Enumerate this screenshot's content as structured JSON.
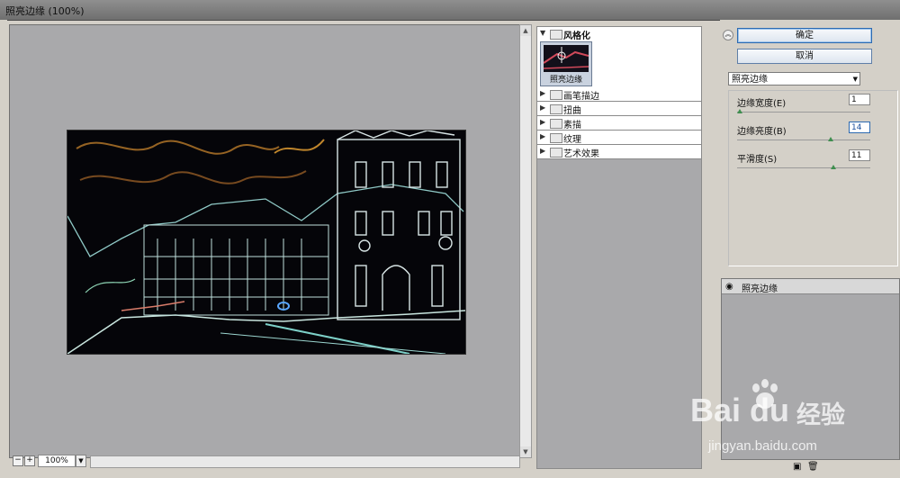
{
  "window": {
    "title": "照亮边缘 (100%)"
  },
  "preview": {
    "zoom": "100%",
    "zoom_out_icon": "minus-icon",
    "zoom_in_icon": "plus-icon"
  },
  "gallery": {
    "expanded_category": {
      "label": "风格化",
      "thumbnail_label": "照亮边缘"
    },
    "categories": [
      {
        "label": "画笔描边"
      },
      {
        "label": "扭曲"
      },
      {
        "label": "素描"
      },
      {
        "label": "纹理"
      },
      {
        "label": "艺术效果"
      }
    ]
  },
  "settings": {
    "ok_label": "确定",
    "cancel_label": "取消",
    "filter_select": "照亮边缘",
    "params": [
      {
        "label": "边缘宽度(E)",
        "value": "1",
        "level": 0.02
      },
      {
        "label": "边缘亮度(B)",
        "value": "14",
        "level": 0.7
      },
      {
        "label": "平滑度(S)",
        "value": "11",
        "level": 0.72
      }
    ]
  },
  "layers": {
    "items": [
      {
        "label": "照亮边缘"
      }
    ]
  },
  "watermark": {
    "logo": "Bai du",
    "cn": "经验",
    "url": "jingyan.baidu.com"
  },
  "colors": {
    "accent": "#2d6ab0",
    "preview_bg": "#a9a9ab",
    "slider_thumb": "#3f8f4f"
  }
}
